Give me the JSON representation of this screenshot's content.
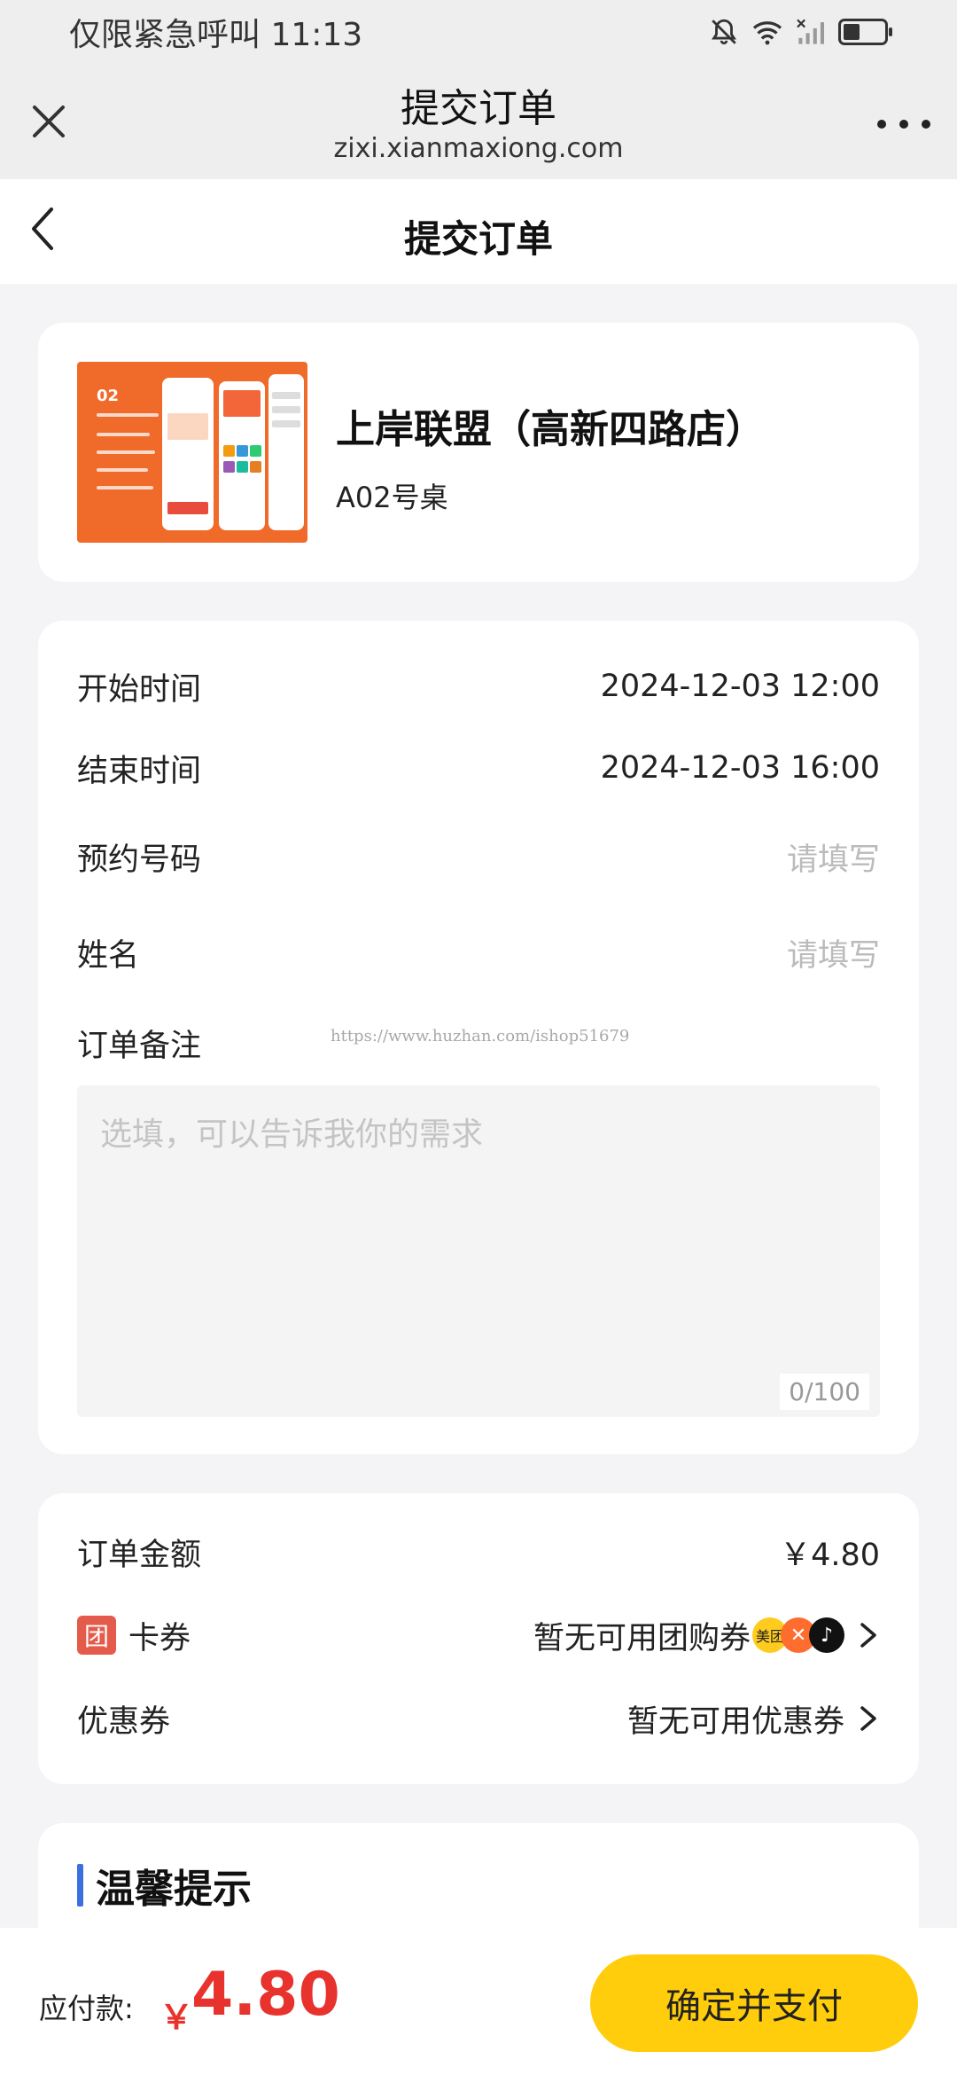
{
  "status_bar": {
    "carrier": "仅限紧急呼叫",
    "time": "11:13"
  },
  "browser": {
    "title": "提交订单",
    "url": "zixi.xianmaxiong.com"
  },
  "nav": {
    "title": "提交订单"
  },
  "store": {
    "name": "上岸联盟（高新四路店）",
    "table": "A02号桌",
    "thumb_badge": "02"
  },
  "form": {
    "start_label": "开始时间",
    "start_value": "2024-12-03 12:00",
    "end_label": "结束时间",
    "end_value": "2024-12-03 16:00",
    "booking_label": "预约号码",
    "booking_placeholder": "请填写",
    "name_label": "姓名",
    "name_placeholder": "请填写",
    "note_label": "订单备注",
    "note_placeholder": "选填，可以告诉我你的需求",
    "note_count": "0/100",
    "watermark": "https://www.huzhan.com/ishop51679"
  },
  "amount": {
    "order_label": "订单金额",
    "order_value": "￥4.80",
    "card_icon": "团",
    "card_label": "卡券",
    "card_value": "暂无可用团购券",
    "meituan_badge": "美团",
    "coupon_label": "优惠券",
    "coupon_value": "暂无可用优惠券"
  },
  "tips": {
    "title": "温馨提示"
  },
  "footer": {
    "pay_label": "应付款:",
    "currency": "￥",
    "amount": "4.80",
    "button": "确定并支付"
  },
  "colors": {
    "accent_yellow": "#ffcd0b",
    "price_red": "#e8322e",
    "tip_bar_blue": "#3c6fe0",
    "thumb_orange": "#f06a2a"
  }
}
